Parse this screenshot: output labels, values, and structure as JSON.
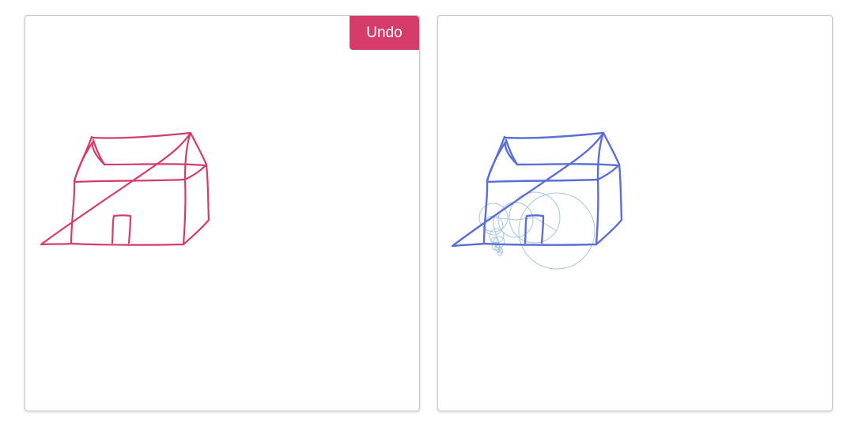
{
  "left_panel": {
    "undo_label": "Undo",
    "stroke_color": "#d63c6a",
    "button_color": "#d63c6a"
  },
  "right_panel": {
    "stroke_color": "#5b6fd6",
    "circle_color": "#a7c6de"
  }
}
